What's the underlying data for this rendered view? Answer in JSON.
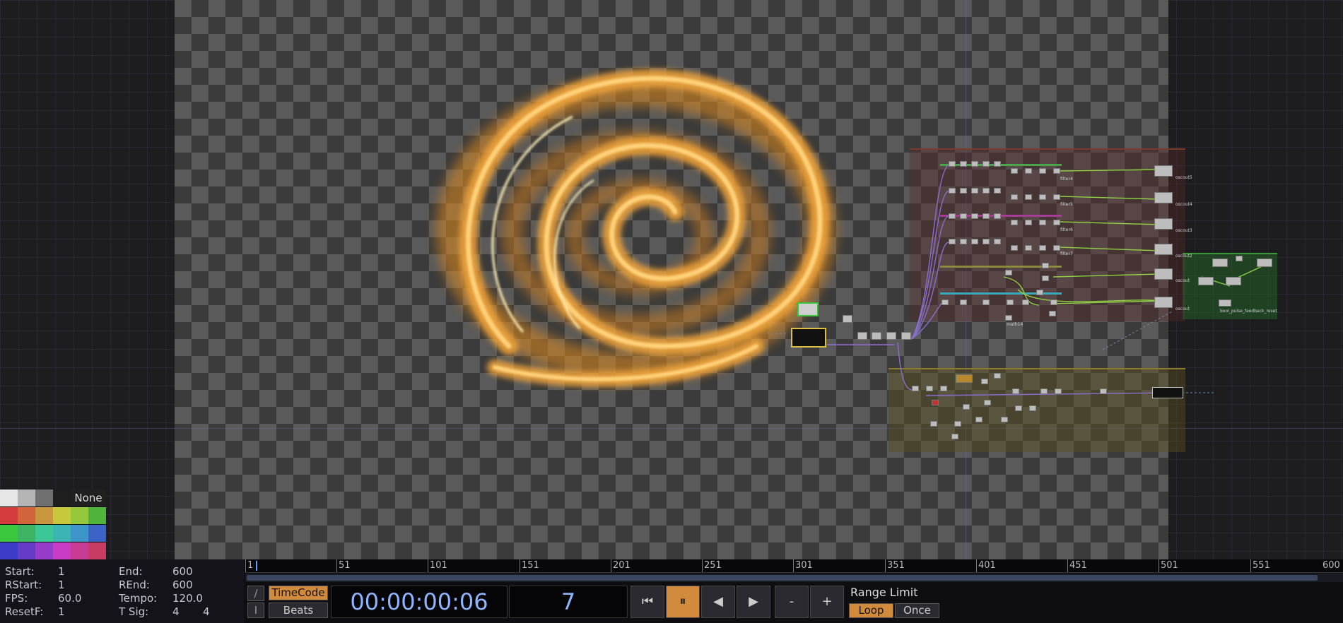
{
  "palette": {
    "none_label": "None",
    "swatches": [
      "#e6e6e6",
      "#b4b4b4",
      "#707070",
      "#1e1e1e",
      "#d23c3c",
      "#d2643c",
      "#c8963c",
      "#c8c83c",
      "#96c83c",
      "#50b43c",
      "#3cc83c",
      "#3cb464",
      "#3cc896",
      "#3cb4b4",
      "#3c96c8",
      "#3c64c8",
      "#3c3cc8",
      "#643cc8",
      "#963cc8",
      "#c83cc8",
      "#c83c96",
      "#c83c64"
    ]
  },
  "stats": {
    "start_label": "Start:",
    "start_value": "1",
    "rstart_label": "RStart:",
    "rstart_value": "1",
    "fps_label": "FPS:",
    "fps_value": "60.0",
    "resetf_label": "ResetF:",
    "resetf_value": "1",
    "end_label": "End:",
    "end_value": "600",
    "rend_label": "REnd:",
    "rend_value": "600",
    "tempo_label": "Tempo:",
    "tempo_value": "120.0",
    "tsig_label": "T Sig:",
    "tsig_num": "4",
    "tsig_den": "4"
  },
  "timeline": {
    "ticks": [
      "1",
      "51",
      "101",
      "151",
      "201",
      "251",
      "301",
      "351",
      "401",
      "451",
      "501",
      "551",
      "600"
    ],
    "current_frame": 7
  },
  "transport": {
    "slash_top": "/",
    "slash_bottom": "I",
    "timecode_btn": "TimeCode",
    "beats_btn": "Beats",
    "timecode": "00:00:00:06",
    "frame": "7",
    "rewind_icon": "⏮",
    "pause_icon": "⏸",
    "step_back_icon": "◀",
    "step_fwd_icon": "▶",
    "minus": "-",
    "plus": "+",
    "range_limit": "Range Limit",
    "loop": "Loop",
    "once": "Once"
  },
  "network": {
    "labels": {
      "oscout5": "oscout5",
      "oscout4": "oscout4",
      "oscout3": "oscout3",
      "oscout2": "oscout2",
      "oscout1": "oscout",
      "oscout0": "oscout",
      "feedback": "bool_pulse_feedback_reset",
      "filter4": "filter4",
      "filter5": "filter5",
      "filter6": "filter6",
      "filter7": "filter7",
      "math14": "math14"
    }
  }
}
